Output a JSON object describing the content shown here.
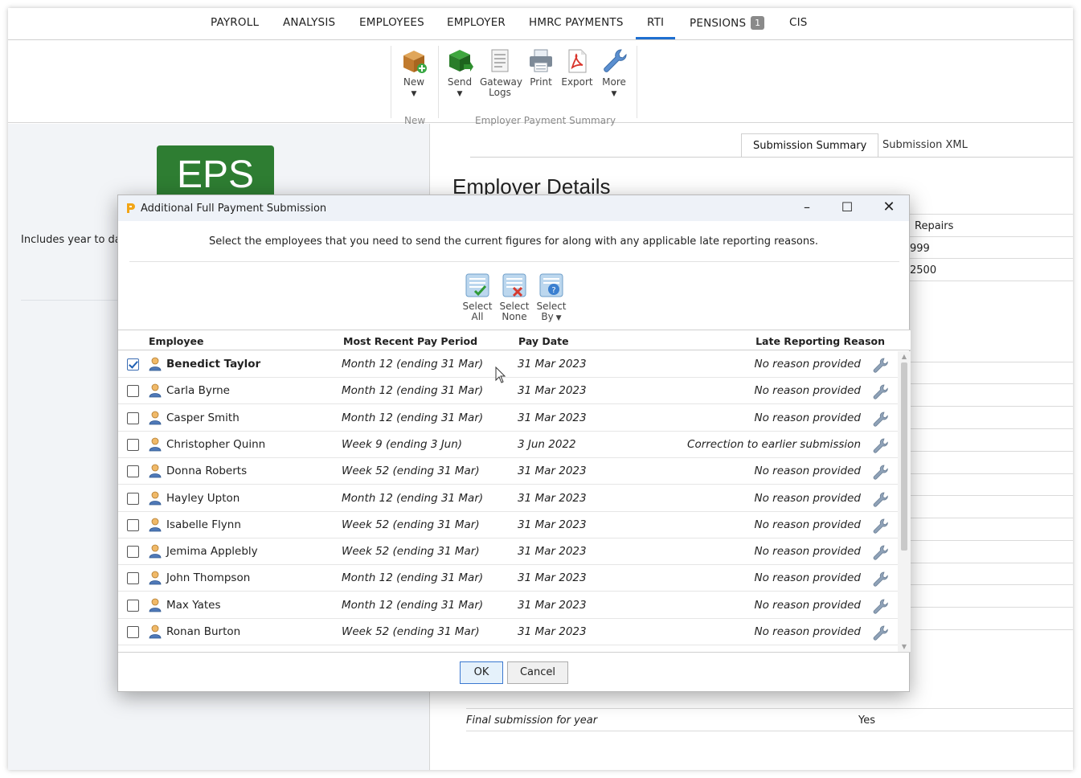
{
  "nav": {
    "tabs": [
      {
        "label": "PAYROLL"
      },
      {
        "label": "ANALYSIS"
      },
      {
        "label": "EMPLOYEES"
      },
      {
        "label": "EMPLOYER"
      },
      {
        "label": "HMRC PAYMENTS"
      },
      {
        "label": "RTI",
        "active": true
      },
      {
        "label": "PENSIONS",
        "badge": "1"
      },
      {
        "label": "CIS"
      }
    ]
  },
  "ribbon": {
    "new_label": "New",
    "new_group": "New",
    "send_label": "Send",
    "gateway_logs_label": "Gateway Logs",
    "print_label": "Print",
    "export_label": "Export",
    "more_label": "More",
    "eps_group": "Employer Payment Summary"
  },
  "left": {
    "eps_logo_text": "EPS",
    "includes_text": "Includes year to date"
  },
  "right": {
    "tabs": {
      "summary": "Submission Summary",
      "xml": "Submission XML"
    },
    "heading": "Employer Details",
    "partial_values": [
      "Repairs",
      "999",
      "2500"
    ],
    "final_label": "Final submission for year",
    "final_value": "Yes"
  },
  "dialog": {
    "title": "Additional Full Payment Submission",
    "instruction": "Select the employees that you need to send the current figures for along with any applicable late reporting reasons.",
    "select_all": "Select All",
    "select_none": "Select None",
    "select_by": "Select By",
    "columns": {
      "employee": "Employee",
      "period": "Most Recent Pay Period",
      "paydate": "Pay Date",
      "reason": "Late Reporting Reason"
    },
    "rows": [
      {
        "name": "Benedict Taylor",
        "period": "Month 12 (ending 31 Mar)",
        "paydate": "31 Mar 2023",
        "reason": "No reason provided",
        "checked": true
      },
      {
        "name": "Carla Byrne",
        "period": "Month 12 (ending 31 Mar)",
        "paydate": "31 Mar 2023",
        "reason": "No reason provided",
        "checked": false
      },
      {
        "name": "Casper Smith",
        "period": "Month 12 (ending 31 Mar)",
        "paydate": "31 Mar 2023",
        "reason": "No reason provided",
        "checked": false
      },
      {
        "name": "Christopher Quinn",
        "period": "Week 9 (ending 3 Jun)",
        "paydate": "3 Jun 2022",
        "reason": "Correction to earlier submission",
        "checked": false
      },
      {
        "name": "Donna Roberts",
        "period": "Week 52 (ending 31 Mar)",
        "paydate": "31 Mar 2023",
        "reason": "No reason provided",
        "checked": false
      },
      {
        "name": "Hayley Upton",
        "period": "Month 12 (ending 31 Mar)",
        "paydate": "31 Mar 2023",
        "reason": "No reason provided",
        "checked": false
      },
      {
        "name": "Isabelle Flynn",
        "period": "Week 52 (ending 31 Mar)",
        "paydate": "31 Mar 2023",
        "reason": "No reason provided",
        "checked": false
      },
      {
        "name": "Jemima Applebly",
        "period": "Week 52 (ending 31 Mar)",
        "paydate": "31 Mar 2023",
        "reason": "No reason provided",
        "checked": false
      },
      {
        "name": "John Thompson",
        "period": "Month 12 (ending 31 Mar)",
        "paydate": "31 Mar 2023",
        "reason": "No reason provided",
        "checked": false
      },
      {
        "name": "Max Yates",
        "period": "Month 12 (ending 31 Mar)",
        "paydate": "31 Mar 2023",
        "reason": "No reason provided",
        "checked": false
      },
      {
        "name": "Ronan Burton",
        "period": "Week 52 (ending 31 Mar)",
        "paydate": "31 Mar 2023",
        "reason": "No reason provided",
        "checked": false
      }
    ],
    "ok_label": "OK",
    "cancel_label": "Cancel"
  },
  "colors": {
    "accent": "#1e6fd0",
    "eps_green": "#2e7d32",
    "dialog_titlebar": "#eef2f8"
  }
}
